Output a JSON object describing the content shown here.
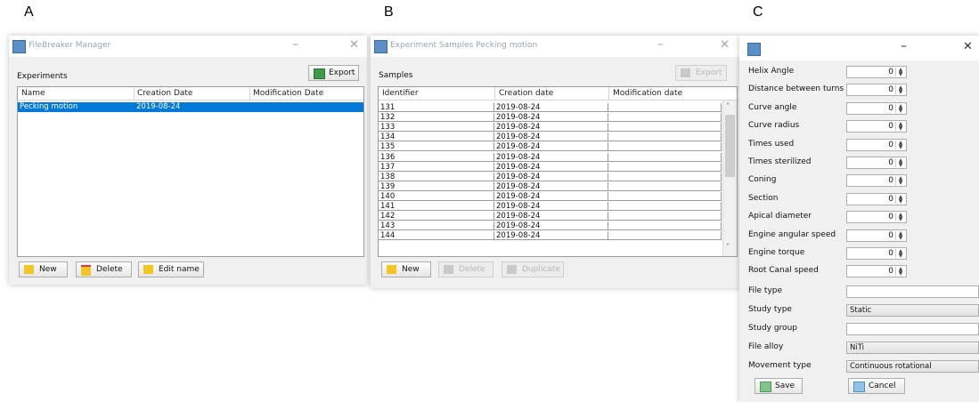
{
  "panels": {
    "a": "A",
    "b": "B",
    "c": "C"
  },
  "colors": {
    "selection": "#0078d7",
    "window_bg": "#f0f0f0",
    "title_text": "#9aa4ad"
  },
  "win_a": {
    "title": "FileBreaker Manager",
    "section_label": "Experiments",
    "export_label": "Export",
    "columns": [
      "Name",
      "Creation Date",
      "Modification Date"
    ],
    "rows": [
      {
        "name": "Pecking motion",
        "created": "2019-08-24",
        "modified": ""
      }
    ],
    "new_label": "New",
    "delete_label": "Delete",
    "edit_label": "Edit name"
  },
  "win_b": {
    "title": "Experiment Samples Pecking motion",
    "section_label": "Samples",
    "export_label": "Export",
    "columns": [
      "Identifier",
      "Creation date",
      "Modification date"
    ],
    "rows": [
      {
        "id": "131",
        "created": "2019-08-24",
        "modified": ""
      },
      {
        "id": "132",
        "created": "2019-08-24",
        "modified": ""
      },
      {
        "id": "133",
        "created": "2019-08-24",
        "modified": ""
      },
      {
        "id": "134",
        "created": "2019-08-24",
        "modified": ""
      },
      {
        "id": "135",
        "created": "2019-08-24",
        "modified": ""
      },
      {
        "id": "136",
        "created": "2019-08-24",
        "modified": ""
      },
      {
        "id": "137",
        "created": "2019-08-24",
        "modified": ""
      },
      {
        "id": "138",
        "created": "2019-08-24",
        "modified": ""
      },
      {
        "id": "139",
        "created": "2019-08-24",
        "modified": ""
      },
      {
        "id": "140",
        "created": "2019-08-24",
        "modified": ""
      },
      {
        "id": "141",
        "created": "2019-08-24",
        "modified": ""
      },
      {
        "id": "142",
        "created": "2019-08-24",
        "modified": ""
      },
      {
        "id": "143",
        "created": "2019-08-24",
        "modified": ""
      },
      {
        "id": "144",
        "created": "2019-08-24",
        "modified": ""
      }
    ],
    "new_label": "New",
    "delete_label": "Delete",
    "duplicate_label": "Duplicate"
  },
  "win_c": {
    "spinners": [
      {
        "label": "Helix Angle",
        "value": "0"
      },
      {
        "label": "Distance between turns",
        "value": "0"
      },
      {
        "label": "Curve angle",
        "value": "0"
      },
      {
        "label": "Curve radius",
        "value": "0"
      },
      {
        "label": "Times used",
        "value": "0"
      },
      {
        "label": "Times sterilized",
        "value": "0"
      },
      {
        "label": "Coning",
        "value": "0"
      },
      {
        "label": "Section",
        "value": "0"
      },
      {
        "label": "Apical diameter",
        "value": "0"
      },
      {
        "label": "Engine angular speed",
        "value": "0"
      },
      {
        "label": "Engine torque",
        "value": "0"
      },
      {
        "label": "Root Canal speed",
        "value": "0"
      }
    ],
    "file_type_label": "File type",
    "file_type_value": "",
    "study_type_label": "Study type",
    "study_type_value": "Static",
    "study_group_label": "Study group",
    "study_group_value": "",
    "file_alloy_label": "File alloy",
    "file_alloy_value": "NiTi",
    "movement_type_label": "Movement type",
    "movement_type_value": "Continuous rotational",
    "save_label": "Save",
    "cancel_label": "Cancel"
  }
}
